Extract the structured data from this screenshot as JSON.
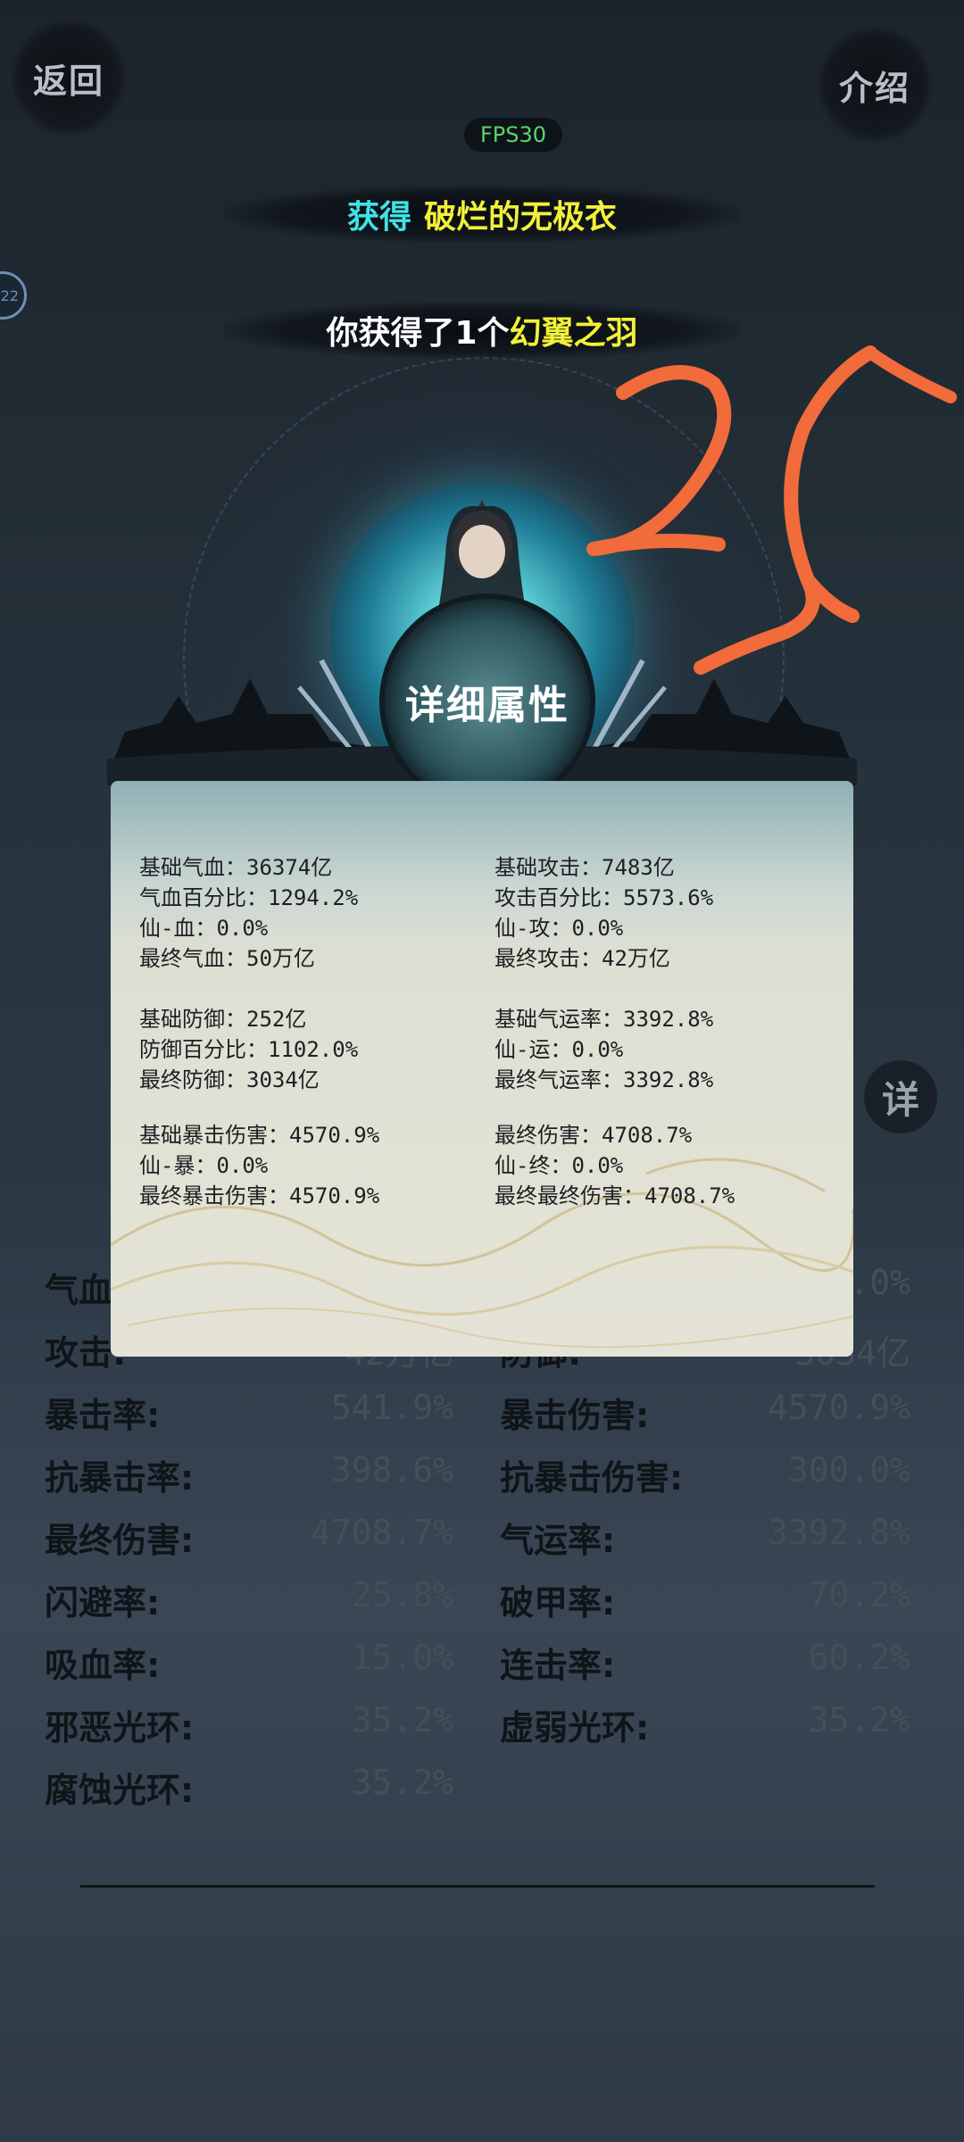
{
  "header": {
    "back_label": "返回",
    "intro_label": "介绍",
    "fps_label": "FPS30"
  },
  "notifications": {
    "obtain_prefix": "获得",
    "obtain_item": "破烂的无极衣",
    "gained_prefix": "你获得了1个",
    "gained_item": "幻翼之羽"
  },
  "side_badge": "22",
  "detail_title": "详细属性",
  "detail_attributes": {
    "left": [
      [
        "基础气血：36374亿",
        "气血百分比：1294.2%",
        "仙-血：0.0%",
        "最终气血：50万亿"
      ],
      [
        "基础防御：252亿",
        "防御百分比：1102.0%",
        "最终防御：3034亿"
      ],
      [
        "基础暴击伤害：4570.9%",
        "仙-暴：0.0%",
        "最终暴击伤害：4570.9%"
      ]
    ],
    "right": [
      [
        "基础攻击：7483亿",
        "攻击百分比：5573.6%",
        "仙-攻：0.0%",
        "最终攻击：42万亿"
      ],
      [
        "基础气运率：3392.8%",
        "仙-运：0.0%",
        "最终气运率：3392.8%"
      ],
      [
        "最终伤害：4708.7%",
        "仙-终：0.0%",
        "最终最终伤害：4708.7%"
      ]
    ]
  },
  "stats": {
    "left": [
      {
        "label": "气血",
        "value": ""
      },
      {
        "label": "攻击:",
        "value": "42万亿"
      },
      {
        "label": "暴击率:",
        "value": "541.9%"
      },
      {
        "label": "抗暴击率:",
        "value": "398.6%"
      },
      {
        "label": "最终伤害:",
        "value": "4708.7%"
      },
      {
        "label": "闪避率:",
        "value": "25.8%"
      },
      {
        "label": "吸血率:",
        "value": "15.0%"
      },
      {
        "label": "邪恶光环:",
        "value": "35.2%"
      },
      {
        "label": "腐蚀光环:",
        "value": "35.2%"
      }
    ],
    "right": [
      {
        "label": "",
        "value": ".0%"
      },
      {
        "label": "防御:",
        "value": "3034亿"
      },
      {
        "label": "暴击伤害:",
        "value": "4570.9%"
      },
      {
        "label": "抗暴击伤害:",
        "value": "300.0%"
      },
      {
        "label": "气运率:",
        "value": "3392.8%"
      },
      {
        "label": "破甲率:",
        "value": "70.2%"
      },
      {
        "label": "连击率:",
        "value": "60.2%"
      },
      {
        "label": "虚弱光环:",
        "value": "35.2%"
      }
    ],
    "detail_button": "详"
  },
  "annotation_text": "25",
  "colors": {
    "notif_cyan": "#3fe3e6",
    "notif_yellow": "#f2f03a",
    "fps_green": "#5ad56a",
    "scribble_orange": "#f26b3a"
  }
}
